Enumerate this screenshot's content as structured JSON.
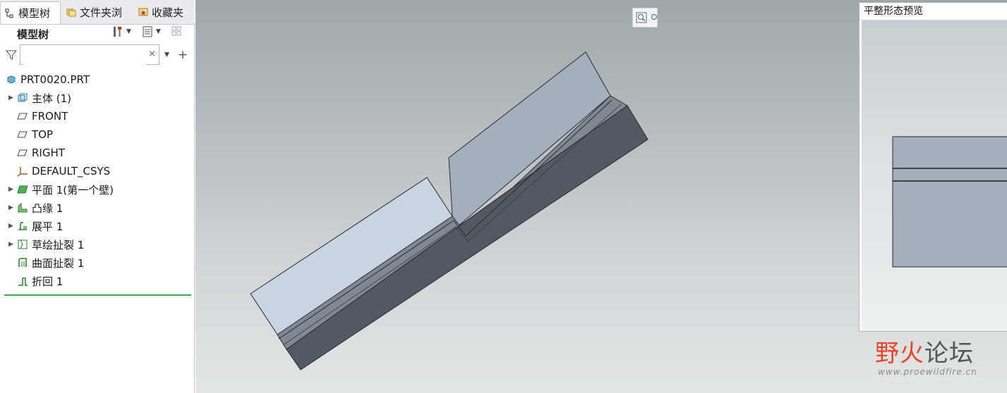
{
  "tabs": [
    {
      "label": "模型树",
      "icon": "tree-icon",
      "active": true
    },
    {
      "label": "文件夹浏",
      "icon": "folder-browser-icon",
      "active": false
    },
    {
      "label": "收藏夹",
      "icon": "favorites-icon",
      "active": false
    }
  ],
  "tree_header": "模型树",
  "search": {
    "value": "",
    "placeholder": ""
  },
  "tree": [
    {
      "label": "PRT0020.PRT",
      "icon": "part-icon",
      "expandable": false
    },
    {
      "label": "主体 (1)",
      "icon": "body-icon",
      "expandable": true
    },
    {
      "label": "FRONT",
      "icon": "datum-plane-icon",
      "expandable": false
    },
    {
      "label": "TOP",
      "icon": "datum-plane-icon",
      "expandable": false
    },
    {
      "label": "RIGHT",
      "icon": "datum-plane-icon",
      "expandable": false
    },
    {
      "label": "DEFAULT_CSYS",
      "icon": "csys-icon",
      "expandable": false
    },
    {
      "label": "平面 1(第一个壁)",
      "icon": "planar-wall-icon",
      "expandable": true
    },
    {
      "label": "凸缘 1",
      "icon": "flange-icon",
      "expandable": true
    },
    {
      "label": "展平 1",
      "icon": "unbend-icon",
      "expandable": true
    },
    {
      "label": "草绘扯裂 1",
      "icon": "sketch-rip-icon",
      "expandable": true
    },
    {
      "label": "曲面扯裂 1",
      "icon": "surface-rip-icon",
      "expandable": false
    },
    {
      "label": "折回 1",
      "icon": "bend-back-icon",
      "expandable": false
    }
  ],
  "preview": {
    "title": "平整形态预览"
  },
  "watermark": {
    "title_a": "野火",
    "title_b": "论坛",
    "url": "www.proewildfire.cn"
  },
  "colors": {
    "accent_green": "#3cb043",
    "part_light": "#c9d3e2",
    "part_mid": "#a3afbe",
    "part_dark": "#535963"
  }
}
